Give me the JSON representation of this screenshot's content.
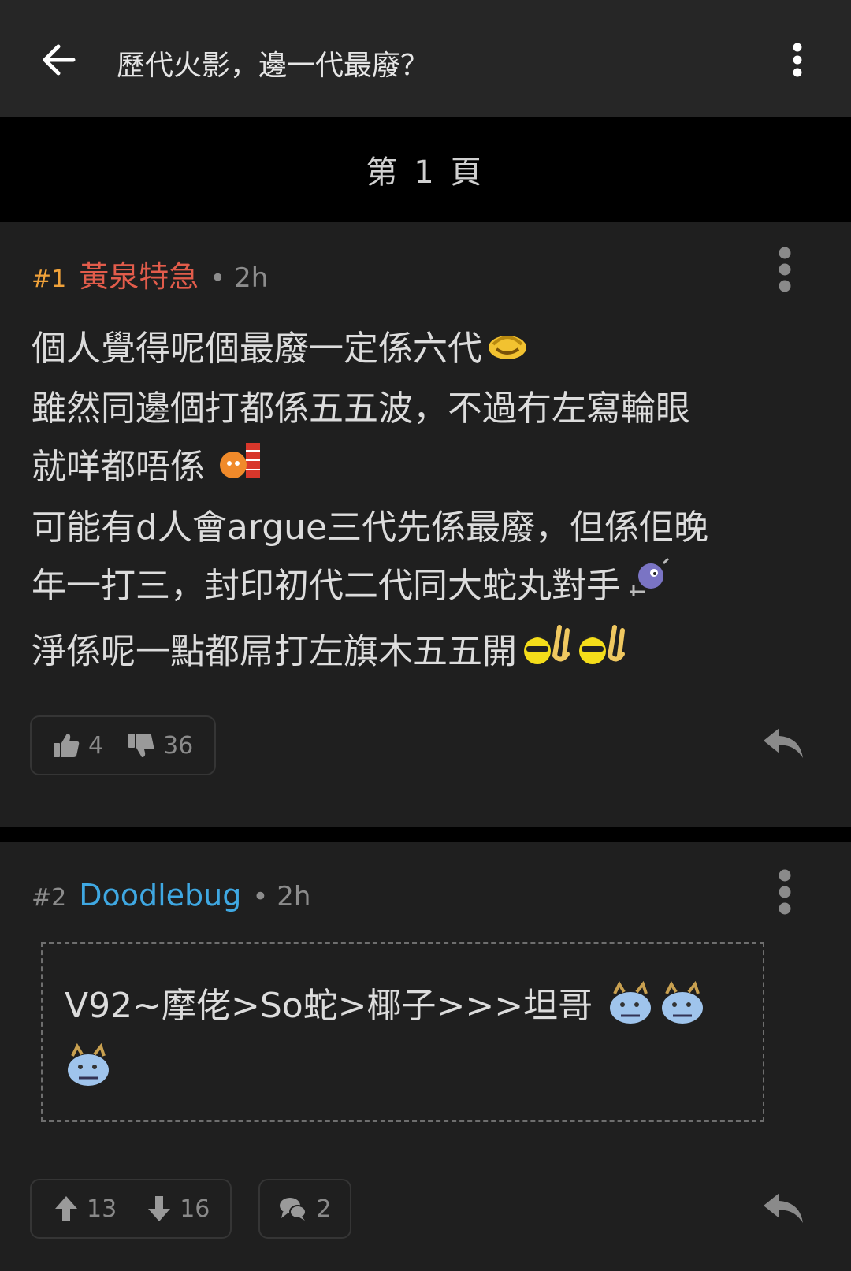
{
  "header": {
    "title": "歷代火影，邊一代最廢？"
  },
  "page_indicator": "第 1 頁",
  "posts": [
    {
      "floor": "#1",
      "username": "黃泉特急",
      "time": "2h",
      "lines": [
        "個人覺得呢個最廢一定係六代",
        "雖然同邊個打都係五五波，不過冇左寫輪眼",
        "就咩都唔係",
        "可能有d人會argue三代先係最廢，但係佢晚",
        "年一打三，封印初代二代同大蛇丸對手",
        "淨係呢一點都屌打左旗木五五開"
      ],
      "likes": "4",
      "dislikes": "36"
    },
    {
      "floor": "#2",
      "username": "Doodlebug",
      "time": "2h",
      "quote": "V92~摩佬>So蛇>椰子>>>坦哥",
      "upvotes": "13",
      "downvotes": "16",
      "comments": "2"
    }
  ]
}
